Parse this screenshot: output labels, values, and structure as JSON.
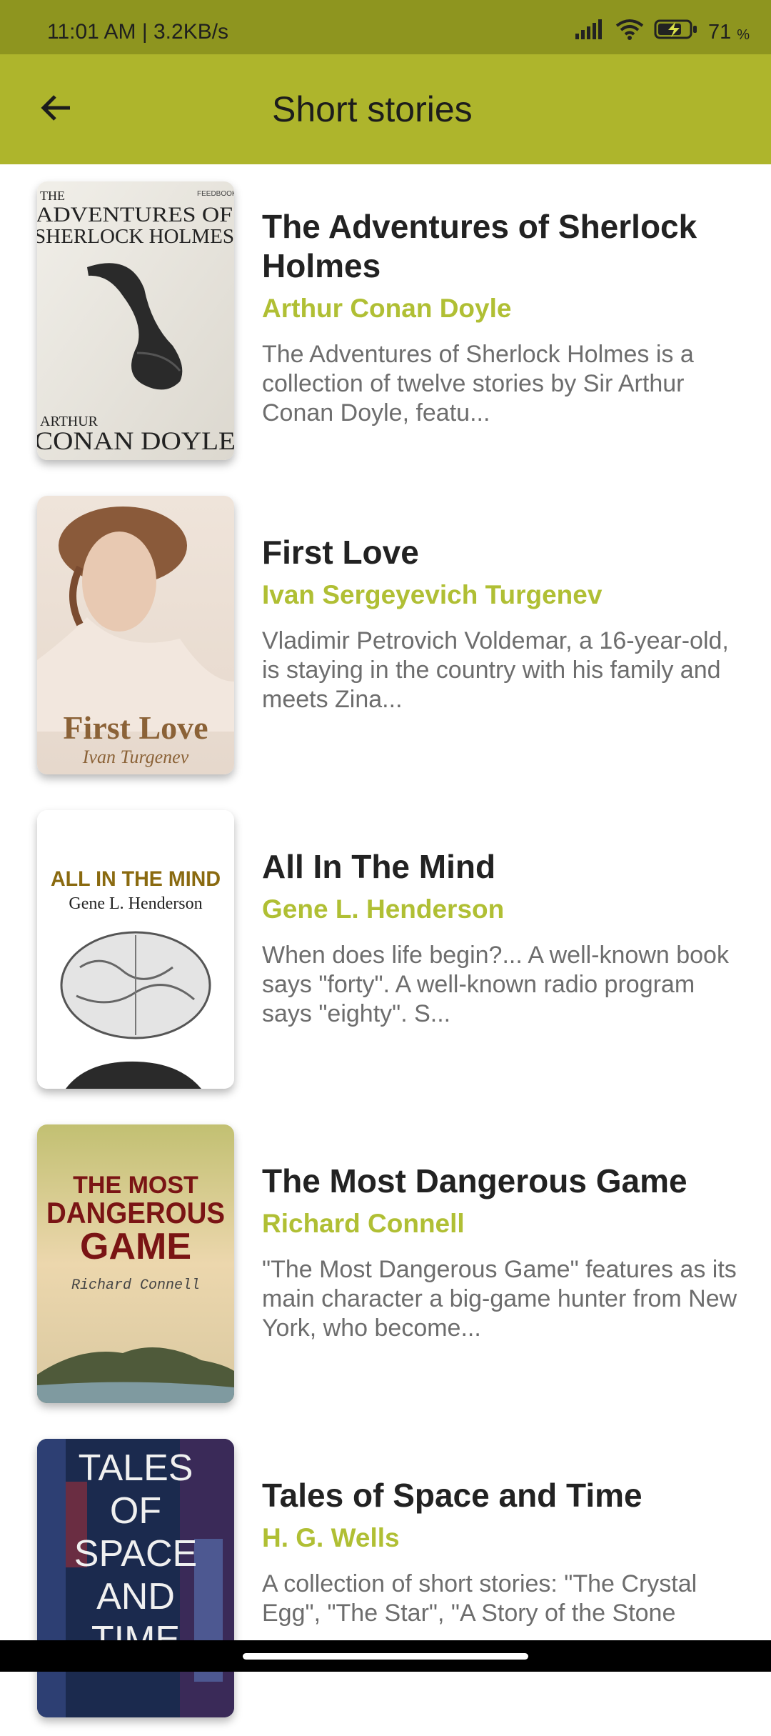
{
  "status": {
    "time": "11:01 AM | 3.2KB/s",
    "battery": "71",
    "battery_unit": "%"
  },
  "appbar": {
    "title": "Short stories"
  },
  "books": [
    {
      "title": "The Adventures of Sherlock Holmes",
      "author": "Arthur Conan Doyle",
      "desc": "The Adventures of Sherlock Holmes is a collection of twelve stories by Sir Arthur Conan Doyle, featu...",
      "cover": {
        "publisher": "FEEDBOOKS",
        "line1": "THE",
        "line2": "ADVENTURES OF",
        "line3": "SHERLOCK HOLMES",
        "author1": "ARTHUR",
        "author2": "CONAN DOYLE"
      }
    },
    {
      "title": "First Love",
      "author": "Ivan Sergeyevich Turgenev",
      "desc": "Vladimir Petrovich Voldemar, a 16-year-old, is staying in the country with his family and meets Zina...",
      "cover": {
        "title": "First Love",
        "author": "Ivan Turgenev"
      }
    },
    {
      "title": "All In The Mind",
      "author": "Gene L. Henderson",
      "desc": "When does life begin?... A well-known book says \"forty\". A well-known radio program says \"eighty\". S...",
      "cover": {
        "title": "ALL IN THE MIND",
        "author": "Gene L. Henderson"
      }
    },
    {
      "title": "The Most Dangerous Game",
      "author": "Richard Connell",
      "desc": "\"The Most Dangerous Game\" features as its main character a big-game hunter from New York, who become...",
      "cover": {
        "line1": "THE MOST",
        "line2": "DANGEROUS",
        "line3": "GAME",
        "author": "Richard Connell"
      }
    },
    {
      "title": "Tales of Space and Time",
      "author": "H. G. Wells",
      "desc": "A collection of short stories: \"The Crystal Egg\", \"The Star\", \"A Story of the Stone",
      "cover": {
        "line1": "TALES",
        "line2": "OF",
        "line3": "SPACE",
        "line4": "AND",
        "line5": "TIME"
      }
    }
  ]
}
